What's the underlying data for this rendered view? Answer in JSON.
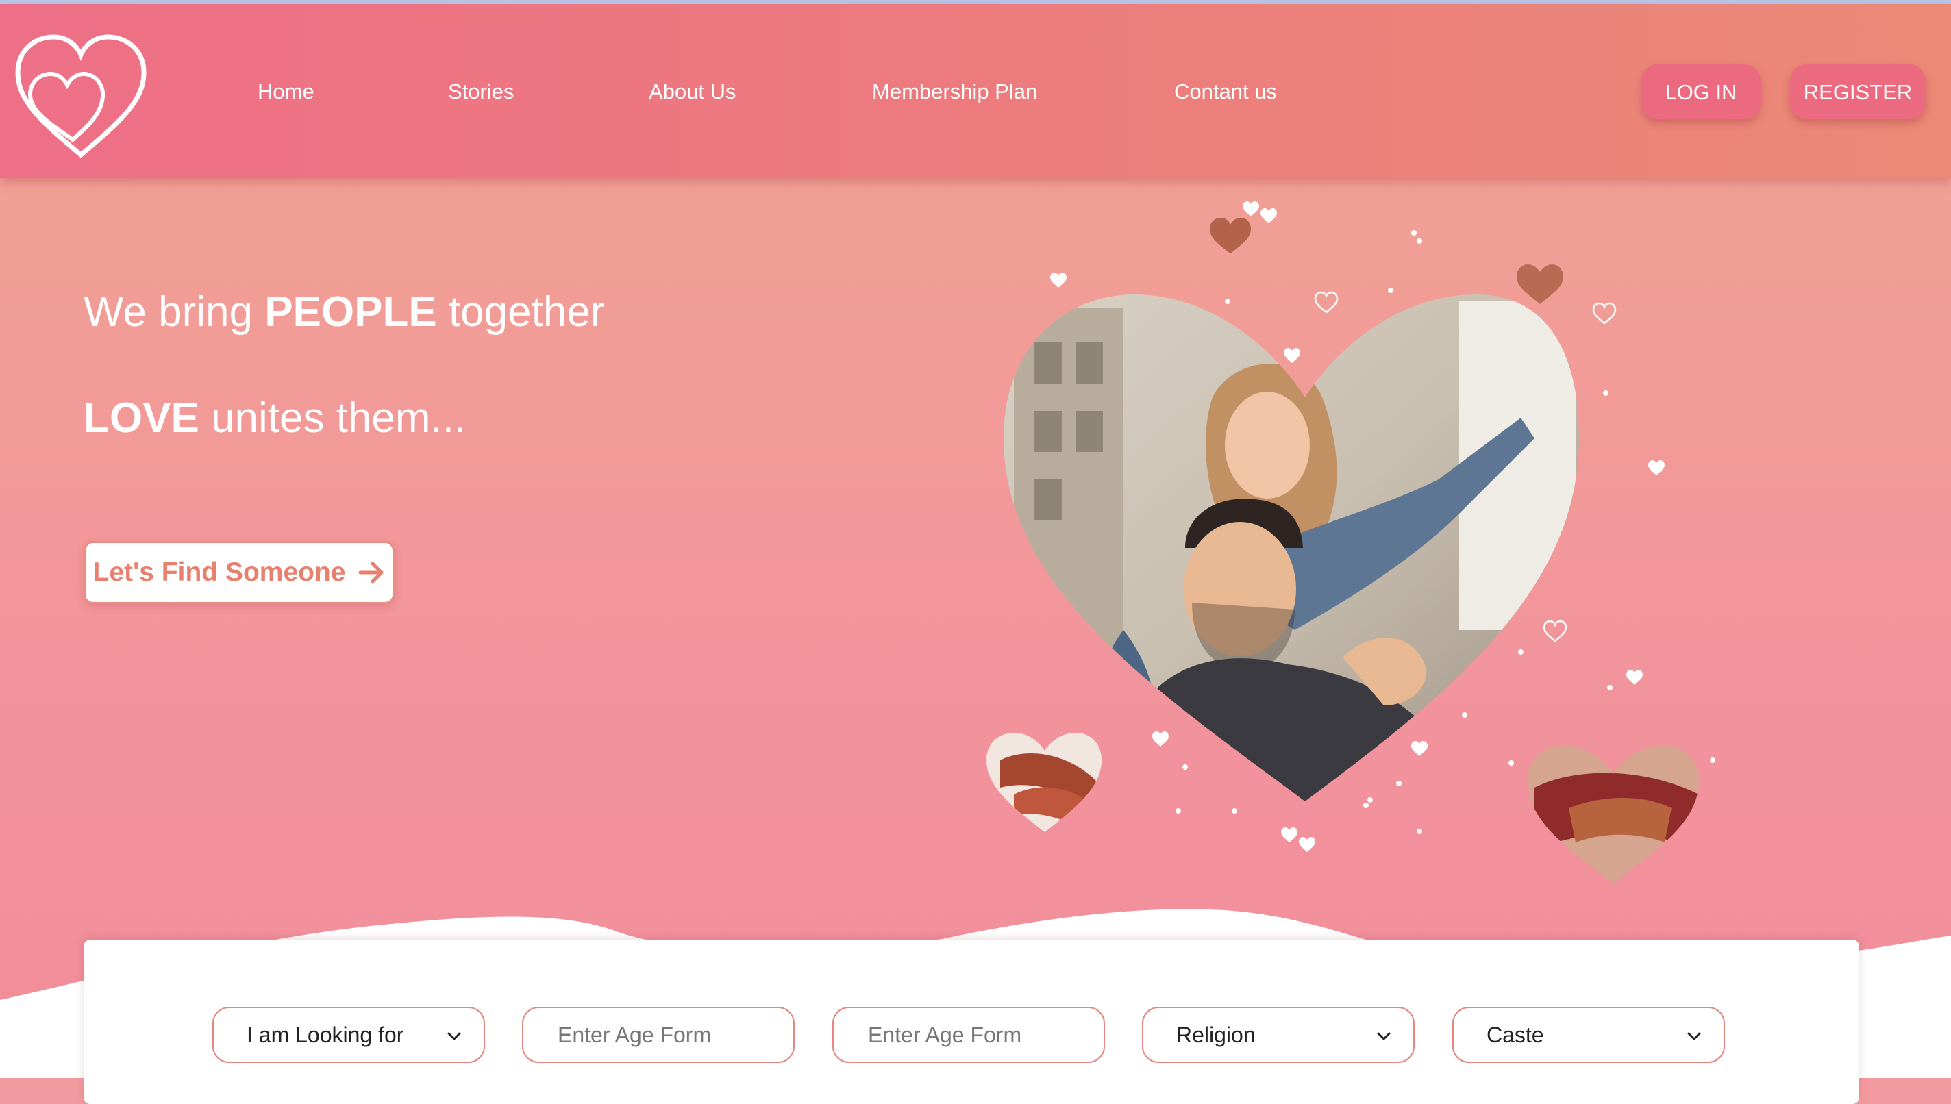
{
  "nav": {
    "items": [
      {
        "label": "Home"
      },
      {
        "label": "Stories"
      },
      {
        "label": "About Us"
      },
      {
        "label": "Membership Plan"
      },
      {
        "label": "Contant us"
      }
    ],
    "login_label": "LOG IN",
    "register_label": "REGISTER"
  },
  "hero": {
    "line1_pre": "We bring ",
    "line1_bold": "PEOPLE",
    "line1_post": " together",
    "line2_bold": "LOVE",
    "line2_post": " unites them...",
    "cta_label": "Let's Find Someone"
  },
  "search": {
    "looking_for": "I am Looking for",
    "age_from_placeholder": "Enter Age Form",
    "age_to_placeholder": "Enter Age Form",
    "religion": "Religion",
    "caste": "Caste"
  },
  "icons": {
    "logo": "double-heart-outline-icon",
    "cta": "arrow-right-icon",
    "select": "chevron-down-icon"
  },
  "colors": {
    "header_start": "#ee6f86",
    "header_end": "#ea8a76",
    "button": "#ec6a7f",
    "accent": "#e8806f"
  }
}
